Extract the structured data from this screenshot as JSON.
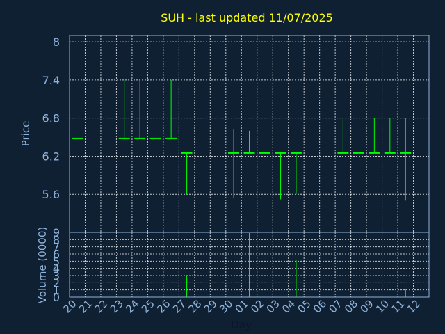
{
  "chart_data": [
    {
      "type": "ohlc",
      "title": "SUH - last updated 11/07/2025",
      "xlabel": "Day",
      "ylabel": "Price",
      "ylim": [
        5.0,
        8.1
      ],
      "yticks": [
        "8",
        "7.4",
        "6.8",
        "6.2",
        "5.6"
      ],
      "grid": true,
      "categories": [
        "20",
        "21",
        "22",
        "23",
        "24",
        "25",
        "26",
        "27",
        "28",
        "29",
        "30",
        "01",
        "02",
        "03",
        "04",
        "05",
        "06",
        "07",
        "08",
        "09",
        "10",
        "11",
        "12"
      ],
      "x_tick_labels": [
        "20",
        "21",
        "22",
        "23",
        "24",
        "25",
        "26",
        "27",
        "28",
        "29",
        "30",
        "01",
        "02",
        "03",
        "04",
        "05",
        "06",
        "07",
        "08",
        "09",
        "10",
        "11",
        "12"
      ],
      "bars": [
        {
          "day": "20",
          "open": 6.48,
          "high": 6.48,
          "low": 6.48,
          "close": 6.48
        },
        {
          "day": "23",
          "open": 6.48,
          "high": 7.4,
          "low": 6.48,
          "close": 6.48
        },
        {
          "day": "24",
          "open": 6.48,
          "high": 7.4,
          "low": 6.48,
          "close": 6.48
        },
        {
          "day": "25",
          "open": 6.48,
          "high": 6.48,
          "low": 6.48,
          "close": 6.48
        },
        {
          "day": "26",
          "open": 6.48,
          "high": 7.4,
          "low": 6.48,
          "close": 6.48
        },
        {
          "day": "27",
          "open": 6.25,
          "high": 6.25,
          "low": 5.6,
          "close": 6.25
        },
        {
          "day": "30",
          "open": 6.25,
          "high": 6.62,
          "low": 5.54,
          "close": 6.25
        },
        {
          "day": "01",
          "open": 6.25,
          "high": 6.6,
          "low": 6.25,
          "close": 6.25
        },
        {
          "day": "02",
          "open": 6.25,
          "high": 6.25,
          "low": 6.25,
          "close": 6.25
        },
        {
          "day": "03",
          "open": 6.25,
          "high": 6.25,
          "low": 5.52,
          "close": 6.25
        },
        {
          "day": "04",
          "open": 6.25,
          "high": 6.25,
          "low": 5.6,
          "close": 6.25
        },
        {
          "day": "07",
          "open": 6.25,
          "high": 6.8,
          "low": 6.25,
          "close": 6.25
        },
        {
          "day": "08",
          "open": 6.25,
          "high": 6.25,
          "low": 6.25,
          "close": 6.25
        },
        {
          "day": "09",
          "open": 6.25,
          "high": 6.8,
          "low": 6.25,
          "close": 6.25
        },
        {
          "day": "10",
          "open": 6.25,
          "high": 6.8,
          "low": 6.25,
          "close": 6.25
        },
        {
          "day": "11",
          "open": 6.25,
          "high": 6.8,
          "low": 5.5,
          "close": 6.25
        }
      ]
    },
    {
      "type": "bar",
      "ylabel": "Volume (0000)",
      "ylim": [
        0,
        9
      ],
      "yticks": [
        "9",
        "8",
        "7",
        "6",
        "5",
        "4",
        "3",
        "2",
        "1",
        "0"
      ],
      "grid": true,
      "categories": [
        "20",
        "21",
        "22",
        "23",
        "24",
        "25",
        "26",
        "27",
        "28",
        "29",
        "30",
        "01",
        "02",
        "03",
        "04",
        "05",
        "06",
        "07",
        "08",
        "09",
        "10",
        "11",
        "12"
      ],
      "values": [
        0,
        0,
        0,
        0,
        0,
        0,
        0,
        3.0,
        0,
        0,
        0,
        8.9,
        0,
        0,
        5.2,
        0,
        0,
        0,
        0,
        0,
        0,
        1.1,
        0
      ]
    }
  ],
  "colors": {
    "background": "#0f2033",
    "title": "#ffff00",
    "text": "#8fb4dc",
    "grid": "#ffffff",
    "frame": "#8fb4dc",
    "price_bar": "#00ff00",
    "volume_bar": "#00ff00"
  }
}
